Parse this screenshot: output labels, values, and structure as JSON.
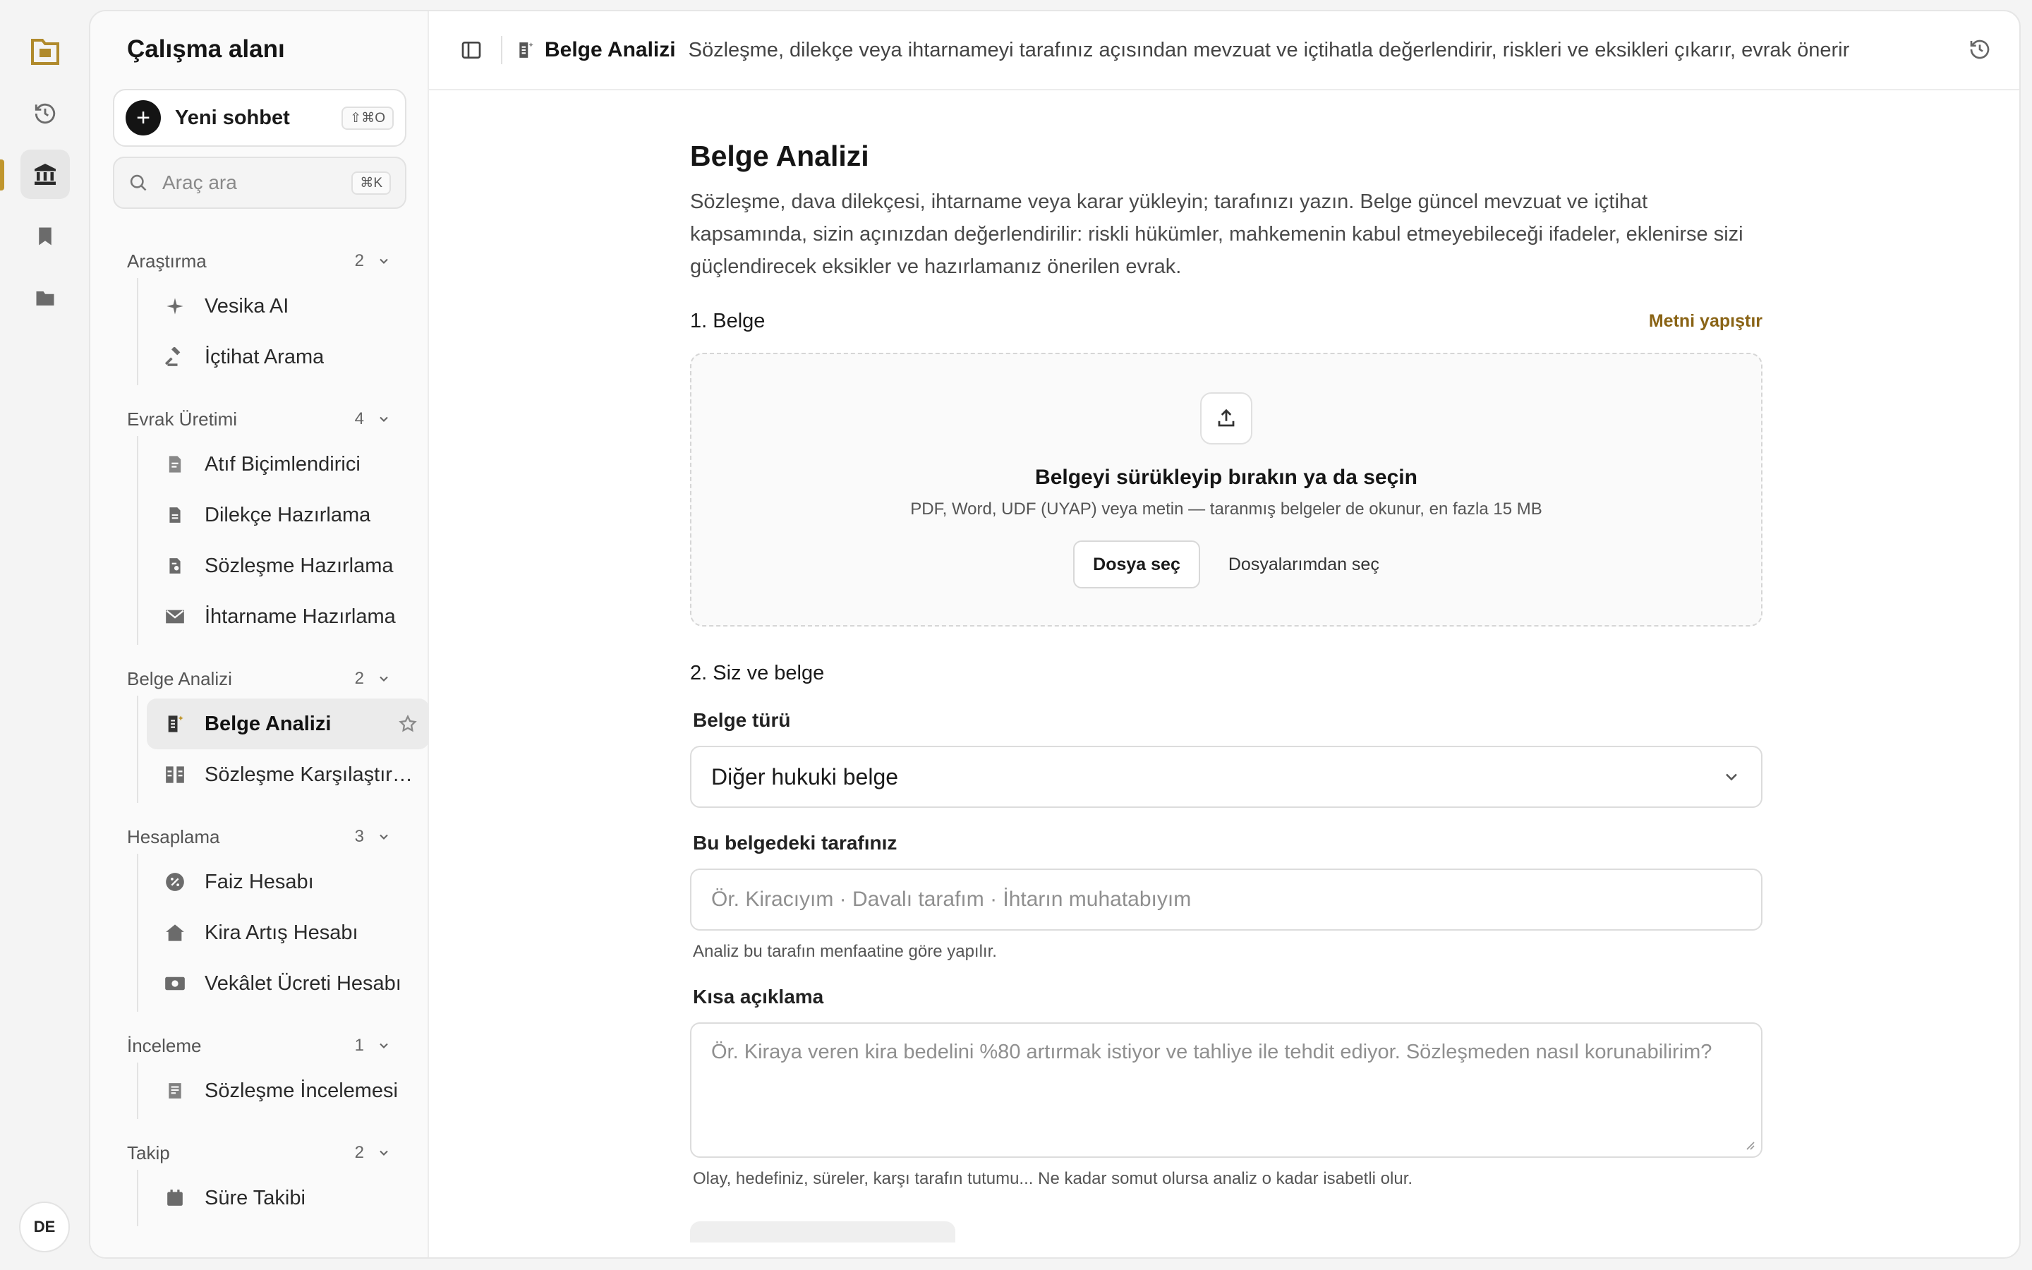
{
  "rail": {
    "avatar": "DE",
    "colors": {
      "accent": "#c0962d"
    }
  },
  "sidebar": {
    "title": "Çalışma alanı",
    "new_chat": {
      "label": "Yeni sohbet",
      "shortcut": "⇧⌘O"
    },
    "search": {
      "placeholder": "Araç ara",
      "shortcut": "⌘K"
    },
    "groups": [
      {
        "label": "Araştırma",
        "count": "2",
        "items": [
          {
            "label": "Vesika AI",
            "icon": "sparkle-icon"
          },
          {
            "label": "İçtihat Arama",
            "icon": "gavel-icon"
          }
        ]
      },
      {
        "label": "Evrak Üretimi",
        "count": "4",
        "items": [
          {
            "label": "Atıf Biçimlendirici",
            "icon": "citation-icon"
          },
          {
            "label": "Dilekçe Hazırlama",
            "icon": "document-icon"
          },
          {
            "label": "Sözleşme Hazırlama",
            "icon": "contract-icon"
          },
          {
            "label": "İhtarname Hazırlama",
            "icon": "envelope-icon"
          }
        ]
      },
      {
        "label": "Belge Analizi",
        "count": "2",
        "items": [
          {
            "label": "Belge Analizi",
            "icon": "document-analysis-icon",
            "active": true
          },
          {
            "label": "Sözleşme Karşılaştır…",
            "icon": "compare-icon"
          }
        ]
      },
      {
        "label": "Hesaplama",
        "count": "3",
        "items": [
          {
            "label": "Faiz Hesabı",
            "icon": "percent-icon"
          },
          {
            "label": "Kira Artış Hesabı",
            "icon": "house-icon"
          },
          {
            "label": "Vekâlet Ücreti Hesabı",
            "icon": "money-icon"
          }
        ]
      },
      {
        "label": "İnceleme",
        "count": "1",
        "items": [
          {
            "label": "Sözleşme İncelemesi",
            "icon": "review-icon"
          }
        ]
      },
      {
        "label": "Takip",
        "count": "2",
        "items": [
          {
            "label": "Süre Takibi",
            "icon": "calendar-icon"
          }
        ]
      }
    ]
  },
  "header": {
    "title": "Belge Analizi",
    "description": "Sözleşme, dilekçe veya ihtarnameyi tarafınız açısından mevzuat ve içtihatla değerlendirir, riskleri ve eksikleri çıkarır, evrak önerir"
  },
  "main": {
    "title": "Belge Analizi",
    "description": "Sözleşme, dava dilekçesi, ihtarname veya karar yükleyin; tarafınızı yazın. Belge güncel mevzuat ve içtihat kapsamında, sizin açınızdan değerlendirilir: riskli hükümler, mahkemenin kabul etmeyebileceği ifadeler, eklenirse sizi güçlendirecek eksikler ve hazırlamanız önerilen evrak.",
    "section1": {
      "title": "1. Belge",
      "paste_label": "Metni yapıştır"
    },
    "dropzone": {
      "title": "Belgeyi sürükleyip bırakın ya da seçin",
      "subtitle": "PDF, Word, UDF (UYAP) veya metin — taranmış belgeler de okunur, en fazla 15 MB",
      "choose_file": "Dosya seç",
      "choose_mine": "Dosyalarımdan seç"
    },
    "section2": {
      "title": "2. Siz ve belge"
    },
    "doc_type": {
      "label": "Belge türü",
      "value": "Diğer hukuki belge"
    },
    "party": {
      "label": "Bu belgedeki tarafınız",
      "placeholder": "Ör. Kiracıyım · Davalı tarafım · İhtarın muhatabıyım",
      "hint": "Analiz bu tarafın menfaatine göre yapılır."
    },
    "summary": {
      "label": "Kısa açıklama",
      "placeholder": "Ör. Kiraya veren kira bedelini %80 artırmak istiyor ve tahliye ile tehdit ediyor. Sözleşmeden nasıl korunabilirim?",
      "hint": "Olay, hedefiniz, süreler, karşı tarafın tutumu... Ne kadar somut olursa analiz o kadar isabetli olur."
    }
  }
}
